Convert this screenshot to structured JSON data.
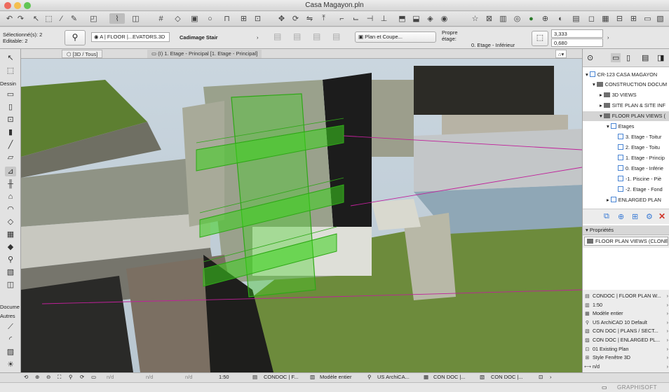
{
  "window": {
    "title": "Casa Magayon.pln"
  },
  "infobox": {
    "selected": "Sélectionné(s): 2",
    "editable": "Editable: 2",
    "layer": "A | FLOOR |...EVATORS.3D",
    "object_name": "Cadimage Stair",
    "display": "Plan et Coupe...",
    "own_floor_label": "Propre",
    "floor_label": "étage:",
    "floor_value": "0. Etage - Inférieur",
    "height_value": "3,333",
    "offset_value": "0,680"
  },
  "tabs": [
    {
      "label": "[3D / Tous]"
    },
    {
      "label": "(I) 1. Etage - Principal [1. Etage - Principal]"
    }
  ],
  "toolbox": {
    "section_drawing": "Dessin",
    "section_document": "Docume",
    "section_other": "Autres"
  },
  "navigator": {
    "root": "CR-123 CASA MAGAYON",
    "construction": "CONSTRUCTION DOCUM",
    "views_3d": "3D VIEWS",
    "site_plan": "SITE PLAN & SITE INF",
    "floor_plan_views": "FLOOR PLAN VIEWS (",
    "etages": "Etages",
    "stories": [
      "3. Etage - Toitur",
      "2. Etage - Toitu",
      "1. Etage - Princip",
      "0. Etage - Inférie",
      "-1. Piscine - Piè",
      "-2. Etage - Fond"
    ],
    "enlarged_plan": "ENLARGED PLAN"
  },
  "properties": {
    "header": "Propriétés",
    "name": "FLOOR PLAN VIEWS (CLONE)",
    "rows": [
      {
        "icon": "layer-combination-icon",
        "label": "CONDOC | FLOOR PLAN W..."
      },
      {
        "icon": "scale-icon",
        "label": "1:50"
      },
      {
        "icon": "structure-display-icon",
        "label": "Modèle entier"
      },
      {
        "icon": "pen-set-icon",
        "label": "US ArchiCAD 10 Default"
      },
      {
        "icon": "model-view-icon",
        "label": "CON DOC | PLANS / SECT..."
      },
      {
        "icon": "graphic-override-icon",
        "label": "CON DOC | ENLARGED PL..."
      },
      {
        "icon": "renovation-icon",
        "label": "01 Existing Plan"
      },
      {
        "icon": "window-style-icon",
        "label": "Style Fenêtre 3D"
      },
      {
        "icon": "dimension-icon",
        "label": "n/d"
      },
      {
        "icon": "zoom-icon",
        "label": "n/d"
      }
    ]
  },
  "statusbar": {
    "nd": "n/d",
    "scale": "1:50",
    "layers": "CONDOC | F...",
    "model": "Modèle entier",
    "pens": "US ArchiCA...",
    "mvo1": "CON DOC |...",
    "mvo2": "CON DOC |..."
  },
  "footer": {
    "brand": "GRAPHISOFT"
  },
  "colors": {
    "stair_green": "#3cd11e",
    "grass": "#6b8a3a",
    "selection_magenta": "#c0209a"
  }
}
